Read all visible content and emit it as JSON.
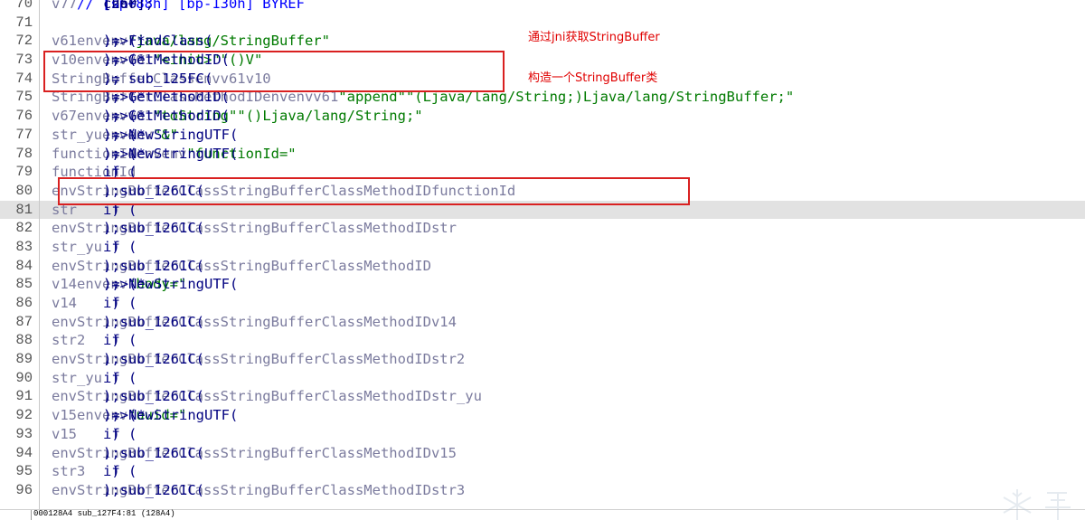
{
  "editor": {
    "lines": [
      {
        "no": "70",
        "segments": [
          [
            "code",
            "char "
          ],
          [
            "var",
            "v77"
          ],
          [
            "code",
            "[260]; "
          ],
          [
            "cm",
            "// [sp+88h] [bp-130h] BYREF"
          ]
        ]
      },
      {
        "no": "71",
        "segments": []
      },
      {
        "no": "72",
        "segments": [
          [
            "var",
            "v61"
          ],
          [
            "code",
            " = (*"
          ],
          [
            "env",
            "env"
          ],
          [
            "code",
            ")->FindClass("
          ],
          [
            "env",
            "env"
          ],
          [
            "code",
            ", "
          ],
          [
            "str",
            "\"java/lang/StringBuffer\""
          ],
          [
            "code",
            ");"
          ]
        ]
      },
      {
        "no": "73",
        "segments": [
          [
            "var",
            "v10"
          ],
          [
            "code",
            " = (*"
          ],
          [
            "env",
            "env"
          ],
          [
            "code",
            ")->GetMethodID("
          ],
          [
            "env",
            "env"
          ],
          [
            "code",
            ", "
          ],
          [
            "var",
            "v61"
          ],
          [
            "code",
            ", "
          ],
          [
            "str",
            "\"<init>\""
          ],
          [
            "code",
            ", "
          ],
          [
            "str",
            "\"()V\""
          ],
          [
            "code",
            ");"
          ]
        ]
      },
      {
        "no": "74",
        "segments": [
          [
            "var",
            "StringBufferClass"
          ],
          [
            "code",
            " = sub_125FC("
          ],
          [
            "env",
            "env"
          ],
          [
            "code",
            ", "
          ],
          [
            "var",
            "v61"
          ],
          [
            "code",
            ", "
          ],
          [
            "var",
            "v10"
          ],
          [
            "code",
            ");"
          ]
        ]
      },
      {
        "no": "75",
        "segments": [
          [
            "var",
            "StringBufferClassMethodID"
          ],
          [
            "code",
            " = (*"
          ],
          [
            "env",
            "env"
          ],
          [
            "code",
            ")->GetMethodID("
          ],
          [
            "env",
            "env"
          ],
          [
            "code",
            ", "
          ],
          [
            "var",
            "v61"
          ],
          [
            "code",
            ", "
          ],
          [
            "str",
            "\"append\""
          ],
          [
            "code",
            ", "
          ],
          [
            "str",
            "\"(Ljava/lang/String;)Ljava/lang/StringBuffer;\""
          ],
          [
            "code",
            ");"
          ]
        ]
      },
      {
        "no": "76",
        "segments": [
          [
            "var",
            "v67"
          ],
          [
            "code",
            " = (*"
          ],
          [
            "env",
            "env"
          ],
          [
            "code",
            ")->GetMethodID("
          ],
          [
            "env",
            "env"
          ],
          [
            "code",
            ", "
          ],
          [
            "var",
            "v61"
          ],
          [
            "code",
            ", "
          ],
          [
            "str",
            "\"toString\""
          ],
          [
            "code",
            ", "
          ],
          [
            "str",
            "\"()Ljava/lang/String;\""
          ],
          [
            "code",
            ");"
          ]
        ]
      },
      {
        "no": "77",
        "segments": [
          [
            "var",
            "str_yu"
          ],
          [
            "code",
            " = (*"
          ],
          [
            "env",
            "env"
          ],
          [
            "code",
            ")->NewStringUTF("
          ],
          [
            "env",
            "env"
          ],
          [
            "code",
            ", "
          ],
          [
            "str",
            "\"&\""
          ],
          [
            "code",
            ");"
          ]
        ]
      },
      {
        "no": "78",
        "segments": [
          [
            "var",
            "functionId"
          ],
          [
            "code",
            " = (*"
          ],
          [
            "env",
            "env"
          ],
          [
            "code",
            ")->NewStringUTF("
          ],
          [
            "env",
            "env"
          ],
          [
            "code",
            ", "
          ],
          [
            "str",
            "\"functionId=\""
          ],
          [
            "code",
            ");"
          ]
        ]
      },
      {
        "no": "79",
        "segments": [
          [
            "code",
            "if ( "
          ],
          [
            "var",
            "functionId"
          ],
          [
            "code",
            " )"
          ]
        ]
      },
      {
        "no": "80",
        "segments": [
          [
            "code",
            "  sub_1261C("
          ],
          [
            "env",
            "env"
          ],
          [
            "code",
            ", "
          ],
          [
            "var",
            "StringBufferClass"
          ],
          [
            "code",
            ", "
          ],
          [
            "var",
            "StringBufferClassMethodID"
          ],
          [
            "code",
            ", "
          ],
          [
            "var",
            "functionId"
          ],
          [
            "code",
            ");"
          ]
        ]
      },
      {
        "no": "81",
        "current": true,
        "segments": [
          [
            "code",
            "if ( "
          ],
          [
            "var",
            "str"
          ],
          [
            "code",
            " )"
          ]
        ]
      },
      {
        "no": "82",
        "segments": [
          [
            "code",
            "  sub_1261C("
          ],
          [
            "env",
            "env"
          ],
          [
            "code",
            ", "
          ],
          [
            "var",
            "StringBufferClass"
          ],
          [
            "code",
            ", "
          ],
          [
            "var",
            "StringBufferClassMethodID"
          ],
          [
            "code",
            ", "
          ],
          [
            "var",
            "str"
          ],
          [
            "code",
            ");"
          ]
        ]
      },
      {
        "no": "83",
        "segments": [
          [
            "code",
            "if ( "
          ],
          [
            "var",
            "str_yu"
          ],
          [
            "code",
            " )"
          ]
        ]
      },
      {
        "no": "84",
        "segments": [
          [
            "code",
            "  sub_1261C("
          ],
          [
            "env",
            "env"
          ],
          [
            "code",
            ", "
          ],
          [
            "var",
            "StringBufferClass"
          ],
          [
            "code",
            ", "
          ],
          [
            "var",
            "StringBufferClassMethodID"
          ],
          [
            "code",
            ");"
          ]
        ]
      },
      {
        "no": "85",
        "segments": [
          [
            "var",
            "v14"
          ],
          [
            "code",
            " = (*"
          ],
          [
            "env",
            "env"
          ],
          [
            "code",
            ")->NewStringUTF("
          ],
          [
            "env",
            "env"
          ],
          [
            "code",
            ", "
          ],
          [
            "str",
            "\"body=\""
          ],
          [
            "code",
            ");"
          ]
        ]
      },
      {
        "no": "86",
        "segments": [
          [
            "code",
            "if ( "
          ],
          [
            "var",
            "v14"
          ],
          [
            "code",
            " )"
          ]
        ]
      },
      {
        "no": "87",
        "segments": [
          [
            "code",
            "  sub_1261C("
          ],
          [
            "env",
            "env"
          ],
          [
            "code",
            ", "
          ],
          [
            "var",
            "StringBufferClass"
          ],
          [
            "code",
            ", "
          ],
          [
            "var",
            "StringBufferClassMethodID"
          ],
          [
            "code",
            ", "
          ],
          [
            "var",
            "v14"
          ],
          [
            "code",
            ");"
          ]
        ]
      },
      {
        "no": "88",
        "segments": [
          [
            "code",
            "if ( "
          ],
          [
            "var",
            "str2"
          ],
          [
            "code",
            " )"
          ]
        ]
      },
      {
        "no": "89",
        "segments": [
          [
            "code",
            "  sub_1261C("
          ],
          [
            "env",
            "env"
          ],
          [
            "code",
            ", "
          ],
          [
            "var",
            "StringBufferClass"
          ],
          [
            "code",
            ", "
          ],
          [
            "var",
            "StringBufferClassMethodID"
          ],
          [
            "code",
            ", "
          ],
          [
            "var",
            "str2"
          ],
          [
            "code",
            ");"
          ]
        ]
      },
      {
        "no": "90",
        "segments": [
          [
            "code",
            "if ( "
          ],
          [
            "var",
            "str_yu"
          ],
          [
            "code",
            " )"
          ]
        ]
      },
      {
        "no": "91",
        "segments": [
          [
            "code",
            "  sub_1261C("
          ],
          [
            "env",
            "env"
          ],
          [
            "code",
            ", "
          ],
          [
            "var",
            "StringBufferClass"
          ],
          [
            "code",
            ", "
          ],
          [
            "var",
            "StringBufferClassMethodID"
          ],
          [
            "code",
            ", "
          ],
          [
            "var",
            "str_yu"
          ],
          [
            "code",
            ");"
          ]
        ]
      },
      {
        "no": "92",
        "segments": [
          [
            "var",
            "v15"
          ],
          [
            "code",
            " = (*"
          ],
          [
            "env",
            "env"
          ],
          [
            "code",
            ")->NewStringUTF("
          ],
          [
            "env",
            "env"
          ],
          [
            "code",
            ", "
          ],
          [
            "str",
            "\"uuid=\""
          ],
          [
            "code",
            ");"
          ]
        ]
      },
      {
        "no": "93",
        "segments": [
          [
            "code",
            "if ( "
          ],
          [
            "var",
            "v15"
          ],
          [
            "code",
            " )"
          ]
        ]
      },
      {
        "no": "94",
        "segments": [
          [
            "code",
            "  sub_1261C("
          ],
          [
            "env",
            "env"
          ],
          [
            "code",
            ", "
          ],
          [
            "var",
            "StringBufferClass"
          ],
          [
            "code",
            ", "
          ],
          [
            "var",
            "StringBufferClassMethodID"
          ],
          [
            "code",
            ", "
          ],
          [
            "var",
            "v15"
          ],
          [
            "code",
            ");"
          ]
        ]
      },
      {
        "no": "95",
        "segments": [
          [
            "code",
            "if ( "
          ],
          [
            "var",
            "str3"
          ],
          [
            "code",
            " )"
          ]
        ]
      },
      {
        "no": "96",
        "segments": [
          [
            "code",
            "  sub_1261C("
          ],
          [
            "env",
            "env"
          ],
          [
            "code",
            ", "
          ],
          [
            "var",
            "StringBufferClass"
          ],
          [
            "code",
            ", "
          ],
          [
            "var",
            "StringBufferClassMethodID"
          ],
          [
            "code",
            ", "
          ],
          [
            "var",
            "str3"
          ],
          [
            "code",
            ");"
          ]
        ]
      }
    ]
  },
  "annotations": {
    "note_findclass": "通过jni获取StringBuffer",
    "note_construct": "构造一个StringBuffer类"
  },
  "statusbar": {
    "text": "000128A4 sub_127F4:81 (128A4)"
  },
  "colors": {
    "highlight_box": "#d92020",
    "annotation_text": "#e00000",
    "current_line_bg": "#e2e2e2",
    "code_text": "#000080",
    "variable": "#7b7b9e",
    "string_literal": "#007a00"
  },
  "icons": {
    "watermark": "snowflake-logo-icon"
  }
}
